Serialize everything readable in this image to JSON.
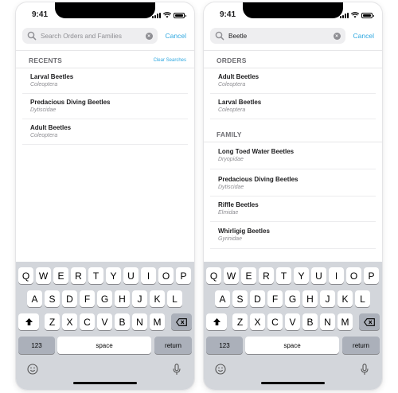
{
  "status_bar": {
    "time": "9:41"
  },
  "left_screen": {
    "search": {
      "placeholder": "Search Orders and Families",
      "cancel": "Cancel"
    },
    "recents": {
      "header": "RECENTS",
      "clear_label": "Clear Searches",
      "items": [
        {
          "title": "Larval Beetles",
          "subtitle": "Coleoptera"
        },
        {
          "title": "Predacious Diving Beetles",
          "subtitle": "Dytiscidae"
        },
        {
          "title": "Adult Beetles",
          "subtitle": "Coleoptera"
        }
      ]
    }
  },
  "right_screen": {
    "search": {
      "value": "Beetle",
      "cancel": "Cancel"
    },
    "orders": {
      "header": "ORDERS",
      "items": [
        {
          "title": "Adult Beetles",
          "subtitle": "Coleoptera"
        },
        {
          "title": "Larval Beetles",
          "subtitle": "Coleoptera"
        }
      ]
    },
    "family": {
      "header": "FAMILY",
      "items": [
        {
          "title": "Long Toed Water Beetles",
          "subtitle": "Dryopidae"
        },
        {
          "title": "Predacious Diving Beetles",
          "subtitle": "Dytiscidae"
        },
        {
          "title": "Riffle Beetles",
          "subtitle": "Elmidae"
        },
        {
          "title": "Whirligig Beetles",
          "subtitle": "Gyrinidae"
        }
      ]
    }
  },
  "keyboard": {
    "row1": [
      "Q",
      "W",
      "E",
      "R",
      "T",
      "Y",
      "U",
      "I",
      "O",
      "P"
    ],
    "row2": [
      "A",
      "S",
      "D",
      "F",
      "G",
      "H",
      "J",
      "K",
      "L"
    ],
    "row3": [
      "Z",
      "X",
      "C",
      "V",
      "B",
      "N",
      "M"
    ],
    "numbers_label": "123",
    "space_label": "space",
    "return_label": "return",
    "icons": [
      "shift-icon",
      "backspace-icon",
      "emoji-icon",
      "microphone-icon"
    ]
  },
  "colors": {
    "accent": "#2ea7e0",
    "keyboard_bg": "#d3d6db",
    "dark_key": "#abb0ba"
  }
}
